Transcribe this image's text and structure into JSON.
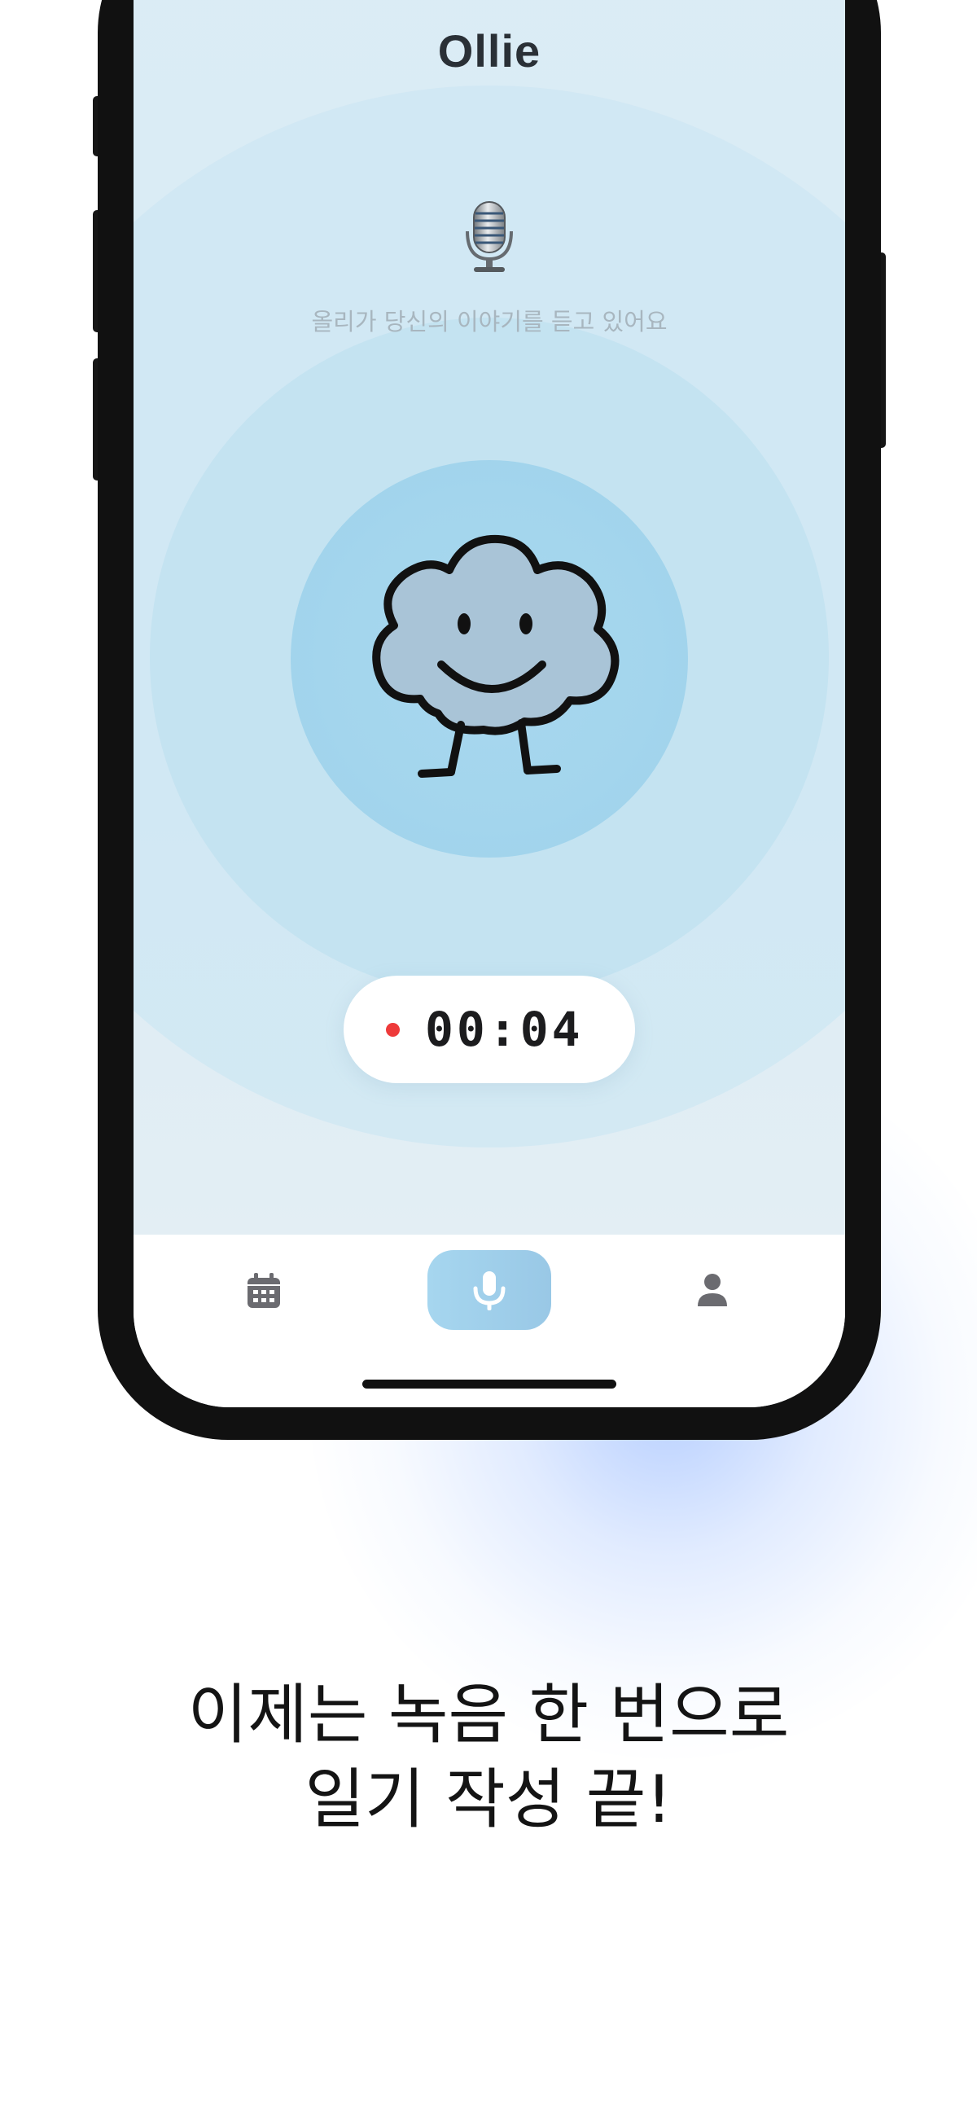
{
  "app": {
    "title": "Ollie"
  },
  "recording": {
    "status_text": "올리가 당신의 이야기를 듣고 있어요",
    "timer": "00:04",
    "indicator_color": "#ee3a3a",
    "status_icon": "studio-microphone-icon",
    "mascot": "cloud-mascot-smiling"
  },
  "tab_bar": {
    "items": [
      {
        "name": "calendar",
        "icon": "calendar-icon",
        "active": false
      },
      {
        "name": "record",
        "icon": "mic-icon",
        "active": true
      },
      {
        "name": "profile",
        "icon": "person-icon",
        "active": false
      }
    ],
    "active_color": "#a6d6ef"
  },
  "promo": {
    "line1": "이제는 녹음 한 번으로",
    "line2": "일기 작성 끝!"
  },
  "colors": {
    "screen_background": "#dbecf5",
    "accent": "#a3d5ed",
    "text_dark": "#141414"
  }
}
